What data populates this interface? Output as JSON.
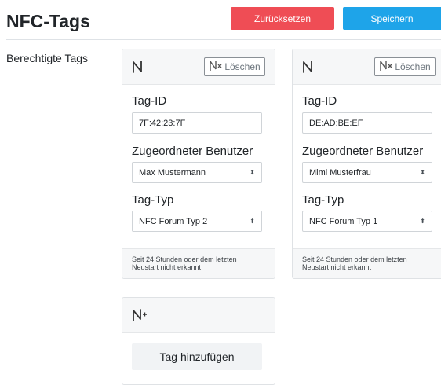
{
  "header": {
    "title": "NFC-Tags",
    "reset_label": "Zurücksetzen",
    "save_label": "Speichern"
  },
  "section": {
    "label": "Berechtigte Tags"
  },
  "tags": [
    {
      "delete_label": "Löschen",
      "tag_id_label": "Tag-ID",
      "tag_id_value": "7F:42:23:7F",
      "user_label": "Zugeordneter Benutzer",
      "user_value": "Max Mustermann",
      "type_label": "Tag-Typ",
      "type_value": "NFC Forum Typ 2",
      "status": "Seit 24 Stunden oder dem letzten Neustart nicht erkannt"
    },
    {
      "delete_label": "Löschen",
      "tag_id_label": "Tag-ID",
      "tag_id_value": "DE:AD:BE:EF",
      "user_label": "Zugeordneter Benutzer",
      "user_value": "Mimi Musterfrau",
      "type_label": "Tag-Typ",
      "type_value": "NFC Forum Typ 1",
      "status": "Seit 24 Stunden oder dem letzten Neustart nicht erkannt"
    }
  ],
  "add": {
    "label": "Tag hinzufügen"
  },
  "icons": {
    "nfc": "nfc-icon",
    "nfc_delete": "nfc-delete-icon",
    "nfc_add": "nfc-add-icon",
    "select_caret": "chevron-up-down-icon"
  },
  "colors": {
    "reset": "#ef4d55",
    "save": "#1ea4e9",
    "card_header": "#f6f7f8"
  }
}
